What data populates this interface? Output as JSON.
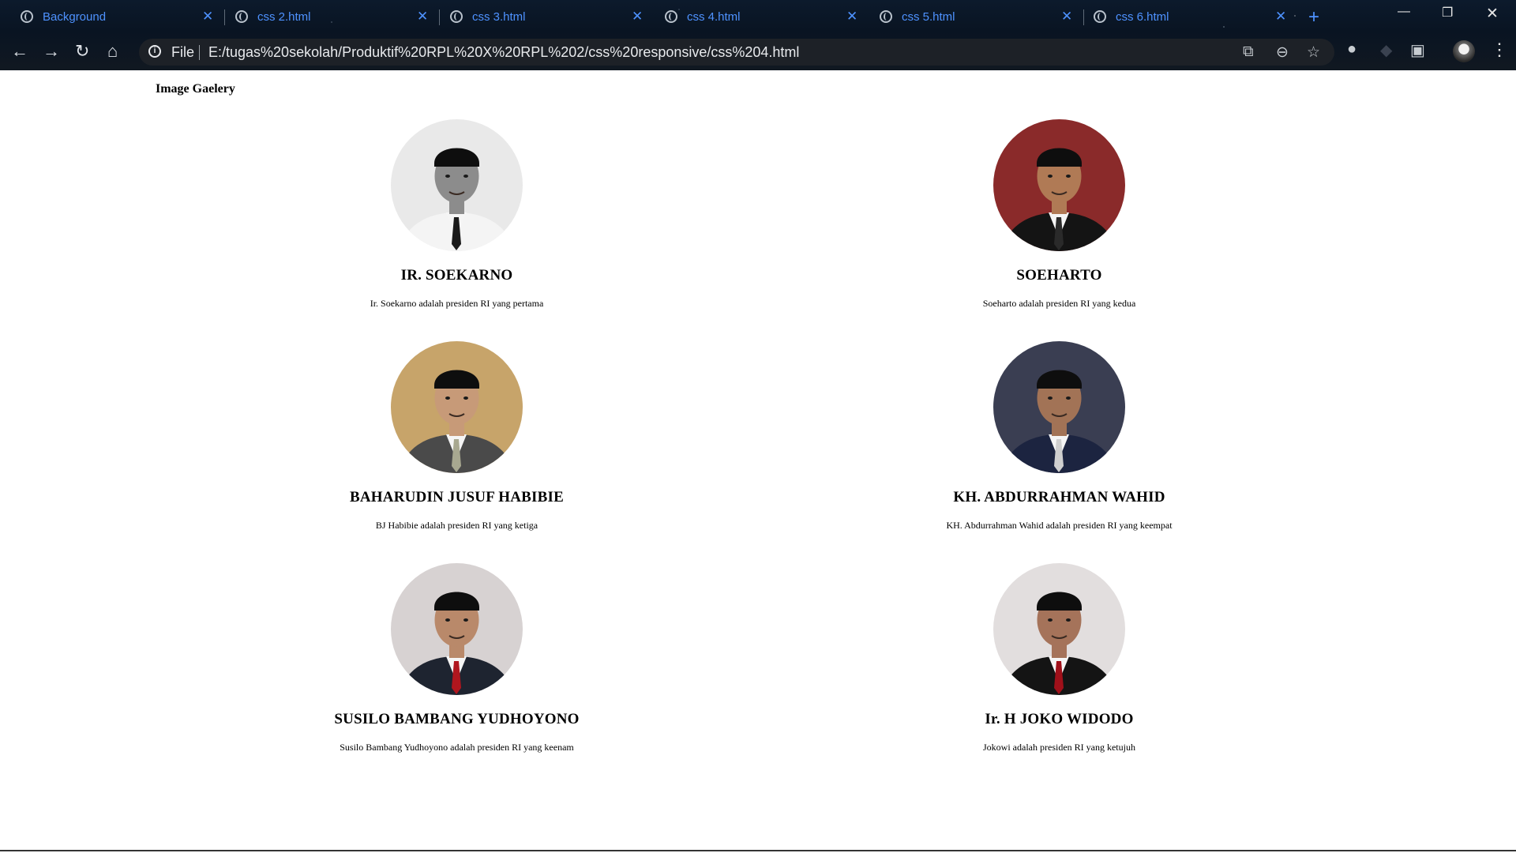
{
  "tabs": [
    {
      "title": "Background"
    },
    {
      "title": "css 2.html"
    },
    {
      "title": "css 3.html"
    },
    {
      "title": "css 4.html"
    },
    {
      "title": "css 5.html"
    },
    {
      "title": "css 6.html"
    }
  ],
  "omnibox": {
    "scheme_label": "File",
    "url": "E:/tugas%20sekolah/Produktif%20RPL%20X%20RPL%202/css%20responsive/css%204.html"
  },
  "page": {
    "title": "Image Gaelery"
  },
  "presidents": [
    {
      "name": "IR. SOEKARNO",
      "desc": "Ir. Soekarno adalah presiden RI yang pertama",
      "bg": "#e9e9e9",
      "suit": "#f4f4f4",
      "skin": "#8c8c8c",
      "tie": "#1a1a1a"
    },
    {
      "name": "SOEHARTO",
      "desc": "Soeharto adalah presiden RI yang kedua",
      "bg": "#8a2a2a",
      "suit": "#141414",
      "skin": "#b07a55",
      "tie": "#2a2a2a"
    },
    {
      "name": "BAHARUDIN JUSUF HABIBIE",
      "desc": "BJ Habibie adalah presiden RI yang ketiga",
      "bg": "#c7a46a",
      "suit": "#4a4a4a",
      "skin": "#c79a78",
      "tie": "#a8a890"
    },
    {
      "name": "KH. ABDURRAHMAN WAHID",
      "desc": "KH. Abdurrahman Wahid adalah presiden RI yang keempat",
      "bg": "#3a3e52",
      "suit": "#1c2440",
      "skin": "#a27356",
      "tie": "#cfcfcf"
    },
    {
      "name": "SUSILO BAMBANG YUDHOYONO",
      "desc": "Susilo Bambang Yudhoyono adalah presiden RI yang keenam",
      "bg": "#d7d2d2",
      "suit": "#1e2430",
      "skin": "#b9896a",
      "tie": "#b0161e"
    },
    {
      "name": "Ir. H JOKO WIDODO",
      "desc": "Jokowi adalah presiden RI yang ketujuh",
      "bg": "#e2dede",
      "suit": "#141414",
      "skin": "#a5735a",
      "tie": "#a0101a"
    }
  ]
}
